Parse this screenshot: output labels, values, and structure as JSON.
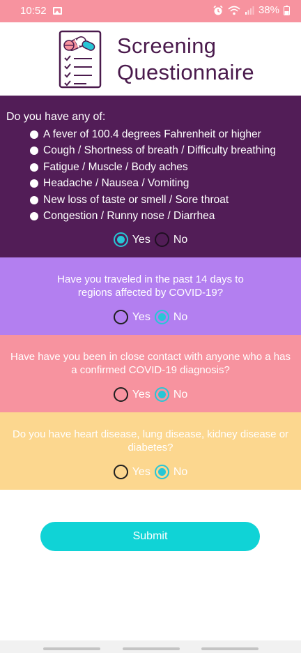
{
  "status_bar": {
    "time": "10:52",
    "battery": "38%",
    "icons": [
      "gallery-icon",
      "alarm-icon",
      "wifi-icon",
      "signal-icon",
      "battery-icon"
    ]
  },
  "header": {
    "title_line1": "Screening",
    "title_line2": "Questionnaire",
    "logo_icon": "clipboard-pills-icon"
  },
  "questions": {
    "symptoms": {
      "question": "Do you have any of:",
      "items": [
        "A fever of 100.4 degrees Fahrenheit or higher",
        "Cough / Shortness of breath / Difficulty breathing",
        "Fatigue / Muscle / Body aches",
        "Headache / Nausea / Vomiting",
        "New loss of taste or smell / Sore throat",
        "Congestion / Runny nose / Diarrhea"
      ],
      "yes_label": "Yes",
      "no_label": "No",
      "selected": "Yes"
    },
    "travel": {
      "line1": "Have you traveled in the past 14 days to",
      "line2": "regions affected by COVID-19?",
      "yes_label": "Yes",
      "no_label": "No",
      "selected": "No"
    },
    "contact": {
      "line1": "Have have you been in close contact with anyone who a has",
      "line2": "a confirmed COVID-19 diagnosis?",
      "yes_label": "Yes",
      "no_label": "No",
      "selected": "No"
    },
    "disease": {
      "line1": "Do you have heart disease, lung disease, kidney disease or",
      "line2": "diabetes?",
      "yes_label": "Yes",
      "no_label": "No",
      "selected": "No"
    }
  },
  "submit_label": "Submit",
  "colors": {
    "status_bar": "#f7939f",
    "title": "#4a1a4c",
    "section_symptoms": "#521d57",
    "section_travel": "#b37ff0",
    "section_contact": "#f7939f",
    "section_disease": "#fcd78f",
    "accent": "#27c6d6",
    "submit": "#10d3d6"
  }
}
